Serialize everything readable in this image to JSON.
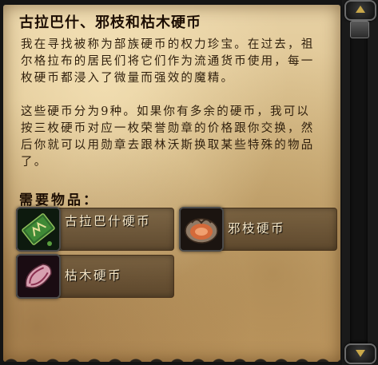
{
  "quest": {
    "title": "古拉巴什、邪枝和枯木硬币",
    "paragraphs": [
      "我在寻找被称为部族硬币的权力珍宝。在过去，祖尔格拉布的居民们将它们作为流通货币使用，每一枚硬币都浸入了微量而强效的魔精。",
      "这些硬币分为9种。如果你有多余的硬币，我可以按三枚硬币对应一枚荣誉勋章的价格跟你交换，然后你就可以用勋章去跟林沃斯换取某些特殊的物品了。"
    ],
    "required_items_heading": "需要物品：",
    "required_items": [
      {
        "name": "古拉巴什硬币",
        "icon": "gurubashi-coin-icon"
      },
      {
        "name": "邪枝硬币",
        "icon": "vilebranch-coin-icon"
      },
      {
        "name": "枯木硬币",
        "icon": "witherbark-coin-icon"
      }
    ]
  },
  "scrollbar": {
    "up_icon": "scroll-up-arrow-icon",
    "down_icon": "scroll-down-arrow-icon"
  }
}
